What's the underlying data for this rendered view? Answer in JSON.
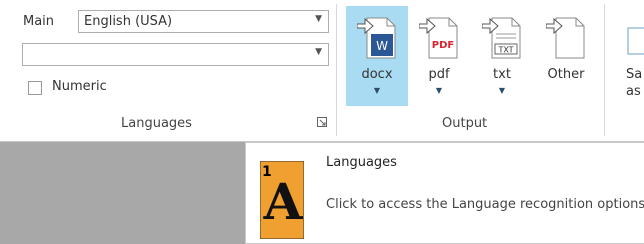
{
  "languages_group": {
    "main_label": "Main",
    "main_value": "English (USA)",
    "secondary_value": "",
    "numeric_label": "Numeric",
    "numeric_checked": false,
    "group_label": "Languages"
  },
  "output_group": {
    "group_label": "Output",
    "buttons": [
      {
        "label": "docx",
        "icon": "docx-file-icon",
        "active": true,
        "has_dropdown": true
      },
      {
        "label": "pdf",
        "icon": "pdf-file-icon",
        "active": false,
        "has_dropdown": true
      },
      {
        "label": "txt",
        "icon": "txt-file-icon",
        "active": false,
        "has_dropdown": true
      },
      {
        "label": "Other",
        "icon": "blank-file-icon",
        "active": false,
        "has_dropdown": false
      }
    ]
  },
  "save_button": {
    "line1": "Sa",
    "line2": "as"
  },
  "tooltip": {
    "title": "Languages",
    "description": "Click to access the Language recognition options",
    "icon_text": "A",
    "icon_number": "1"
  },
  "colors": {
    "active_button": "#a9dcf3",
    "pdf_red": "#d9232e",
    "docx_blue": "#2b5797",
    "icon_orange": "#f0a030"
  }
}
